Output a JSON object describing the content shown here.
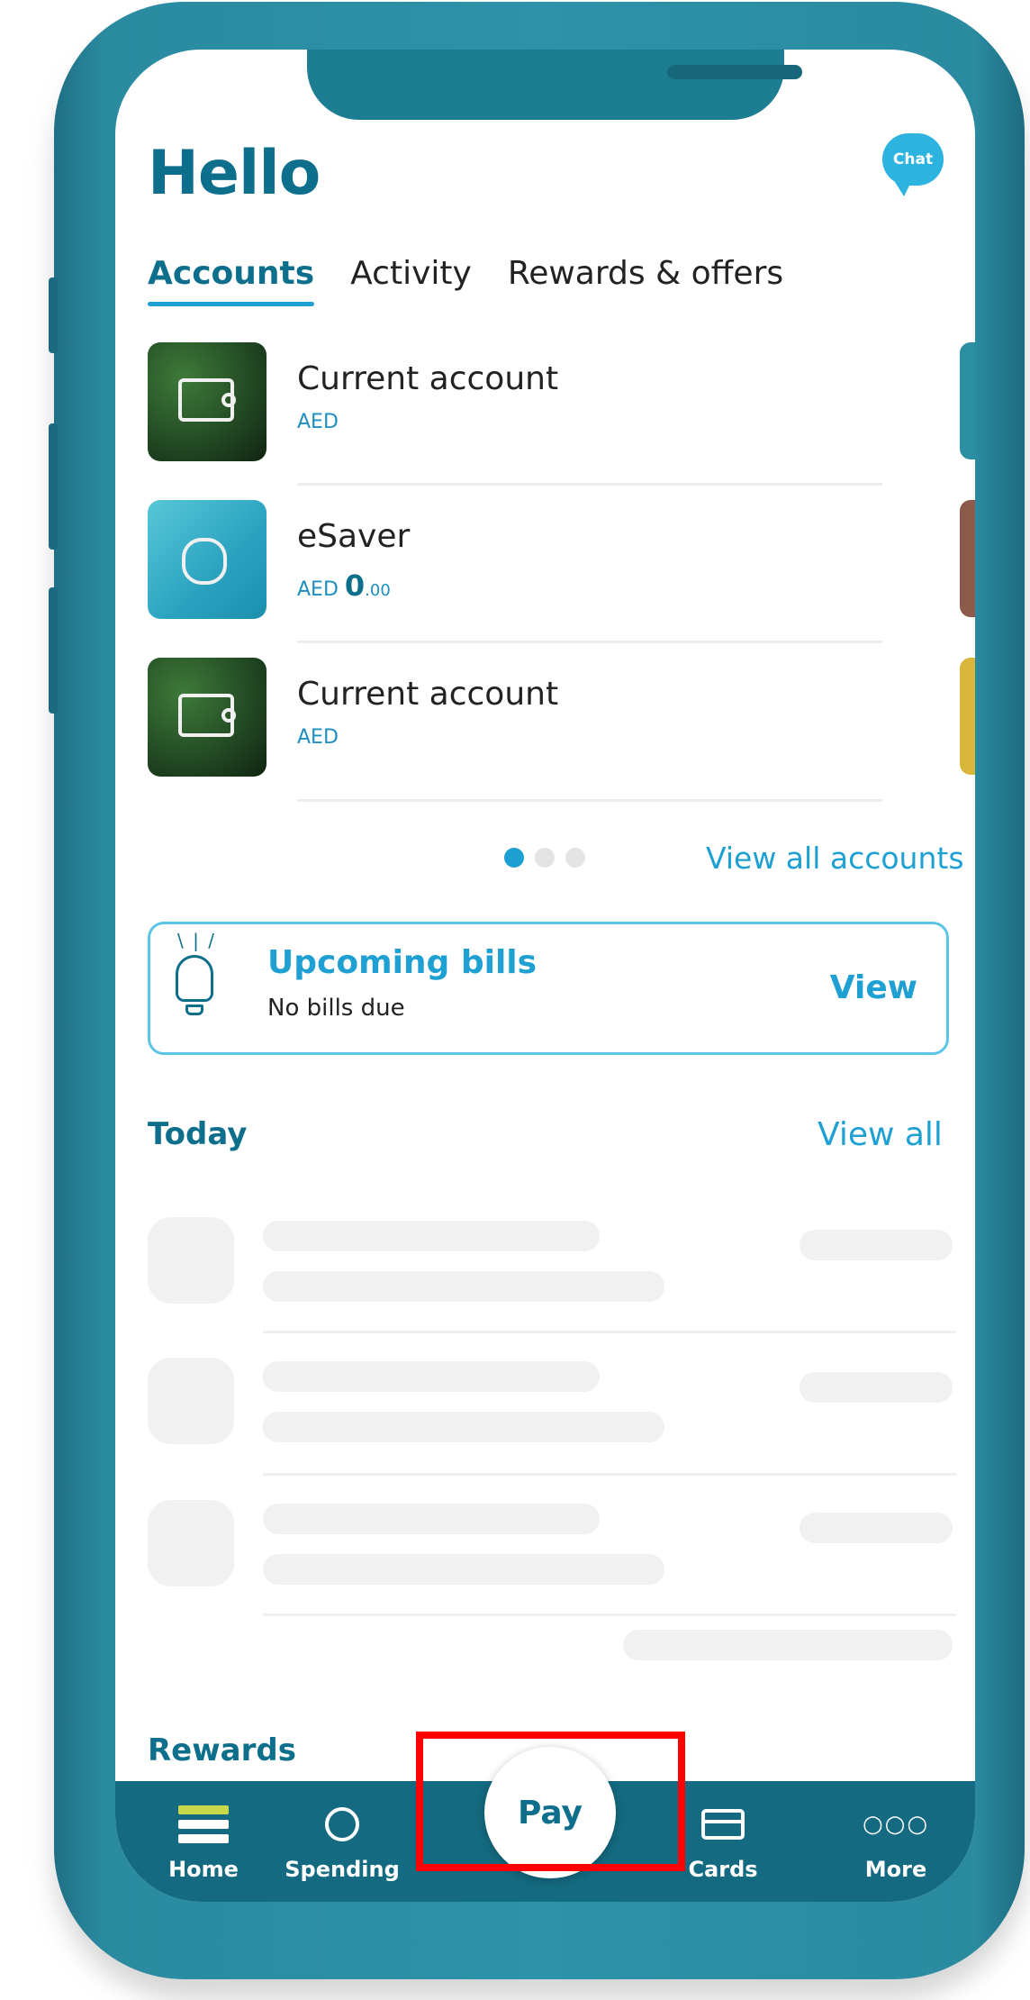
{
  "header": {
    "greeting": "Hello",
    "chat_label": "Chat"
  },
  "tabs": [
    {
      "label": "Accounts",
      "active": true
    },
    {
      "label": "Activity",
      "active": false
    },
    {
      "label": "Rewards & offers",
      "active": false
    }
  ],
  "accounts": [
    {
      "name": "Current account",
      "currency": "AED",
      "amount_main": "",
      "amount_dec": "",
      "image": "leaf-wallet-icon"
    },
    {
      "name": "eSaver",
      "currency": "AED",
      "amount_main": "0",
      "amount_dec": ".00",
      "image": "coins-icon"
    },
    {
      "name": "Current account",
      "currency": "AED",
      "amount_main": "",
      "amount_dec": "",
      "image": "leaf-wallet-icon"
    }
  ],
  "carousel": {
    "active_index": 0,
    "count": 3
  },
  "view_all_accounts": "View all accounts",
  "bills": {
    "title": "Upcoming bills",
    "subtitle": "No bills due",
    "action": "View"
  },
  "today": {
    "title": "Today",
    "action": "View all"
  },
  "rewards": {
    "title": "Rewards"
  },
  "nav": {
    "items": [
      {
        "label": "Home",
        "icon": "home-icon"
      },
      {
        "label": "Spending",
        "icon": "pie-chart-icon"
      },
      {
        "label": "Cards",
        "icon": "card-icon"
      },
      {
        "label": "More",
        "icon": "more-icon"
      }
    ],
    "pay_label": "Pay"
  },
  "colors": {
    "brand_teal": "#0e6f8c",
    "accent_cyan": "#1ea0d2",
    "nav_bg": "#146a80",
    "highlight": "#ff0000"
  }
}
